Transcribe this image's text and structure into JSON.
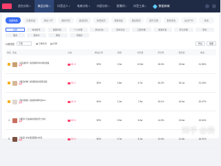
{
  "nav": {
    "items": [
      "造台分析",
      "商品分析",
      "抖音达人",
      "电商分析",
      "内容分析",
      "直播间",
      "抖音工具"
    ],
    "active_index": 1,
    "brand": "数据商城"
  },
  "categories": [
    "全部商品",
    "抖音精选",
    "美妆个护",
    "服饰内衣",
    "食品饮料",
    "家居家纺",
    "母婴用品",
    "箱包配饰",
    "图书文娱",
    "数码家电",
    "运动户外",
    "其他"
  ],
  "active_category": 0,
  "subcategories_row1": [
    "全部",
    "电动剃须",
    "面部护肤",
    "个人护理",
    "香水彩妆",
    "身体清洁",
    "口腔护理",
    "美发护发",
    "男士护理",
    "卸妆",
    "面膜",
    "精华",
    "乳液",
    "防晒",
    "其它"
  ],
  "subcategories_row2": [
    "面霜",
    "爽肤水",
    "眼霜",
    "洗面奶"
  ],
  "active_sub": 0,
  "filters": {
    "label": "价格范围",
    "select": "不限",
    "checks": [
      "只看有货",
      "高佣"
    ],
    "buttons": [
      "导出",
      "收藏"
    ]
  },
  "table": {
    "headers": [
      "排名",
      "商品",
      "价格",
      "佣金比例",
      "销量",
      "浏览量",
      "转化率",
      "销售额",
      "佣金"
    ],
    "rows": [
      {
        "rank": "1",
        "title": "【美妆推荐】高保湿精华补水修护面霜",
        "tag": "品牌",
        "price": "¥1.0",
        "c1": "50%",
        "c2": "2.3w",
        "c3": "12.5w",
        "c4": "18.4%",
        "c5": "22.6w",
        "c6": "21.36%",
        "thumb": "#c8a070"
      },
      {
        "rank": "2",
        "title": "【精选好物】氨基酸温和洁面乳套装",
        "tag": "品牌",
        "price": "¥1.1",
        "c1": "50%",
        "c2": "1.8w",
        "c3": "9.7w",
        "c4": "16.2%",
        "c5": "18.1w",
        "c6": "21.16%",
        "thumb": "#d8b898"
      },
      {
        "rank": "3",
        "title": "【限时特惠】多效修护精华液30ml",
        "tag": "品牌",
        "price": "¥1.5",
        "c1": "50%",
        "c2": "1.2w",
        "c3": "7.9w",
        "c4": "15.1%",
        "c5": "16.9w",
        "c6": "20.47%",
        "thumb": "#e0d8d0"
      },
      {
        "rank": "4",
        "title": "【爆款】控油清爽洗面奶男士专用",
        "tag": "品牌",
        "price": "¥2.0",
        "c1": "50%",
        "c2": "0.9w",
        "c3": "6.3w",
        "c4": "14.0%",
        "c5": "13.8w",
        "c6": "19.04%",
        "thumb": "#c87060"
      },
      {
        "rank": "5",
        "title": "【新品】补水保湿面膜10片装",
        "tag": "品牌",
        "price": "¥2.0",
        "c1": "50%",
        "c2": "0.7w",
        "c3": "5.1w",
        "c4": "13.4%",
        "c5": "11.5w",
        "c6": "18.21%",
        "thumb": "#7a5040"
      }
    ]
  },
  "watermark": "知乎 @美"
}
